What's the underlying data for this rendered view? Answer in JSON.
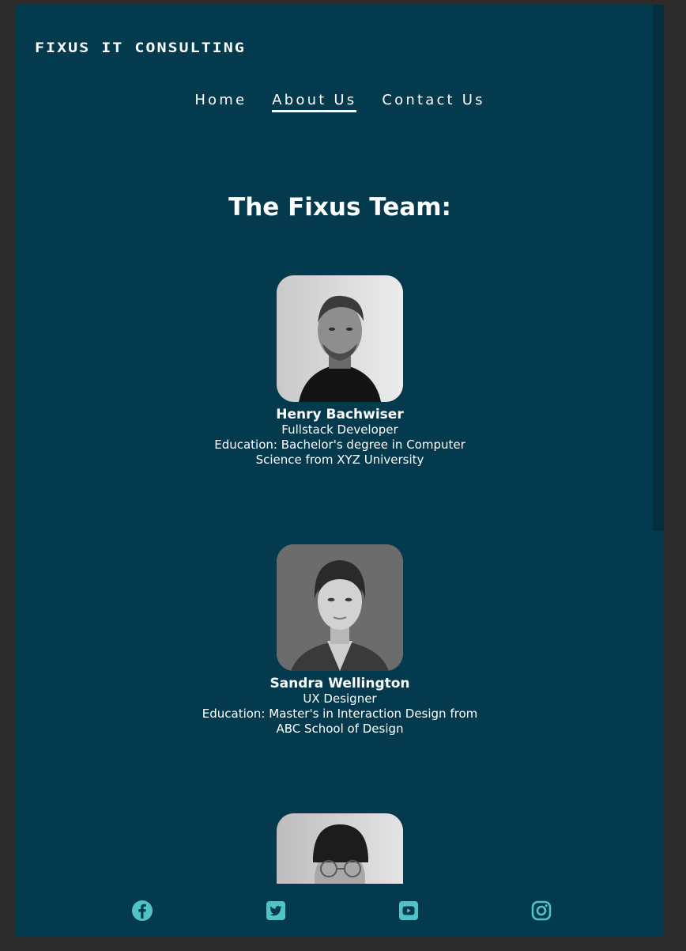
{
  "header": {
    "logo_text": "FIXUS IT CONSULTING"
  },
  "nav": {
    "items": [
      {
        "label": "Home",
        "active": false
      },
      {
        "label": "About Us",
        "active": true
      },
      {
        "label": "Contact Us",
        "active": false
      }
    ]
  },
  "main": {
    "heading": "The Fixus Team:",
    "members": [
      {
        "name": "Henry Bachwiser",
        "role": "Fullstack Developer",
        "education": "Education: Bachelor's degree in Computer Science from XYZ University"
      },
      {
        "name": "Sandra Wellington",
        "role": "UX Designer",
        "education": "Education: Master's in Interaction Design from ABC School of Design"
      }
    ]
  },
  "footer": {
    "icons": [
      "facebook-icon",
      "twitter-icon",
      "youtube-icon",
      "instagram-icon"
    ],
    "icon_color": "#4fc3c7"
  },
  "colors": {
    "background": "#043a4e",
    "text": "#ffffff",
    "accent": "#4fc3c7"
  }
}
